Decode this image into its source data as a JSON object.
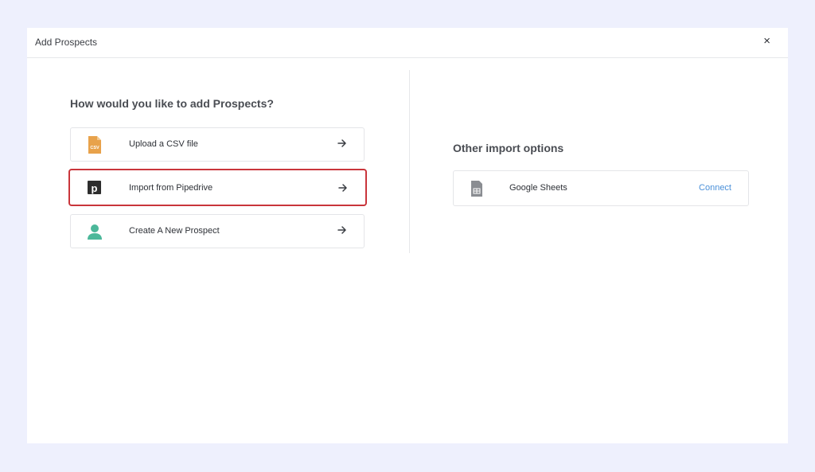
{
  "modal": {
    "title": "Add Prospects",
    "close_label": "×"
  },
  "left": {
    "heading": "How would you like to add Prospects?",
    "options": [
      {
        "label": "Upload a CSV file",
        "icon": "csv-file-icon",
        "icon_text": "CSV",
        "icon_color": "#e8a24b"
      },
      {
        "label": "Import from Pipedrive",
        "icon": "pipedrive-icon",
        "icon_text": "p",
        "icon_color": "#2d2d2d",
        "selected": true
      },
      {
        "label": "Create A New Prospect",
        "icon": "user-icon",
        "icon_color": "#4cb89a"
      }
    ]
  },
  "right": {
    "heading": "Other import options",
    "integrations": [
      {
        "label": "Google Sheets",
        "icon": "google-sheets-icon",
        "action_label": "Connect"
      }
    ]
  },
  "colors": {
    "background": "#eef0fd",
    "selected_border": "#c9353b",
    "link": "#4a90d9"
  }
}
